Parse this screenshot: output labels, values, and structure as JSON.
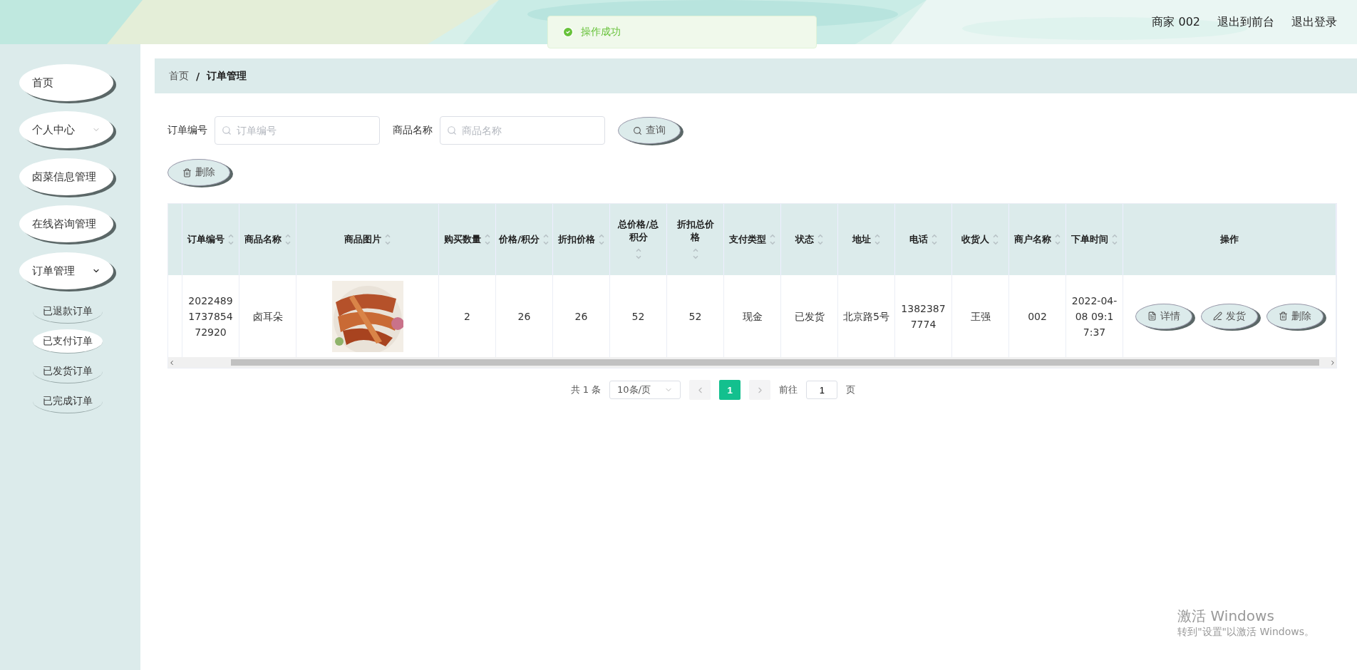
{
  "header": {
    "user": "商家 002",
    "links": [
      "退出到前台",
      "退出登录"
    ]
  },
  "toast": {
    "message": "操作成功"
  },
  "sidebar": {
    "items": [
      {
        "label": "首页"
      },
      {
        "label": "个人中心",
        "expanded": false
      },
      {
        "label": "卤菜信息管理"
      },
      {
        "label": "在线咨询管理"
      },
      {
        "label": "订单管理",
        "expanded": true,
        "children": [
          {
            "label": "已退款订单",
            "selected": false
          },
          {
            "label": "已支付订单",
            "selected": true
          },
          {
            "label": "已发货订单",
            "selected": false
          },
          {
            "label": "已完成订单",
            "selected": false
          }
        ]
      }
    ]
  },
  "breadcrumb": [
    "首页",
    "/",
    "订单管理"
  ],
  "search": {
    "fields": [
      {
        "label": "订单编号",
        "placeholder": "订单编号"
      },
      {
        "label": "商品名称",
        "placeholder": "商品名称"
      }
    ],
    "button": "查询"
  },
  "delete_button": "删除",
  "table": {
    "columns": [
      {
        "sortable": false
      },
      {
        "label": "订单编号",
        "sortable": true
      },
      {
        "label": "商品名称",
        "sortable": true
      },
      {
        "label": "商品图片",
        "sortable": true
      },
      {
        "label": "购买数量",
        "sortable": true
      },
      {
        "label": "价格/积分",
        "sortable": true
      },
      {
        "label": "折扣价格",
        "sortable": true
      },
      {
        "label": "总价格/总积分",
        "sortable": true
      },
      {
        "label": "折扣总价格",
        "sortable": true
      },
      {
        "label": "支付类型",
        "sortable": true
      },
      {
        "label": "状态",
        "sortable": true
      },
      {
        "label": "地址",
        "sortable": true
      },
      {
        "label": "电话",
        "sortable": true
      },
      {
        "label": "收货人",
        "sortable": true
      },
      {
        "label": "商户名称",
        "sortable": true
      },
      {
        "label": "下单时间",
        "sortable": true
      },
      {
        "label": "操作",
        "sortable": false
      }
    ],
    "rows": [
      {
        "cells": [
          null,
          "2022489173785472920",
          "卤耳朵",
          {
            "kind": "picture"
          },
          "2",
          "26",
          "26",
          "52",
          "52",
          "现金",
          "已发货",
          "北京路5号",
          "13823877774",
          "王强",
          "002",
          "2022-04-08 09:17:37",
          {
            "kind": "actions",
            "actions": [
              {
                "kind": "detail",
                "label": "详情"
              },
              {
                "kind": "ship",
                "label": "发货"
              },
              {
                "kind": "delete",
                "label": "删除"
              }
            ]
          }
        ]
      }
    ]
  },
  "pagination": {
    "total": "共 1 条",
    "page_size": "10条/页",
    "pages": [
      {
        "label": "1",
        "selected": true
      }
    ],
    "goto_label": "前往",
    "goto_value": "1",
    "goto_suffix": "页"
  },
  "watermark": {
    "title": "激活 Windows",
    "subtitle": "转到\"设置\"以激活 Windows。"
  }
}
